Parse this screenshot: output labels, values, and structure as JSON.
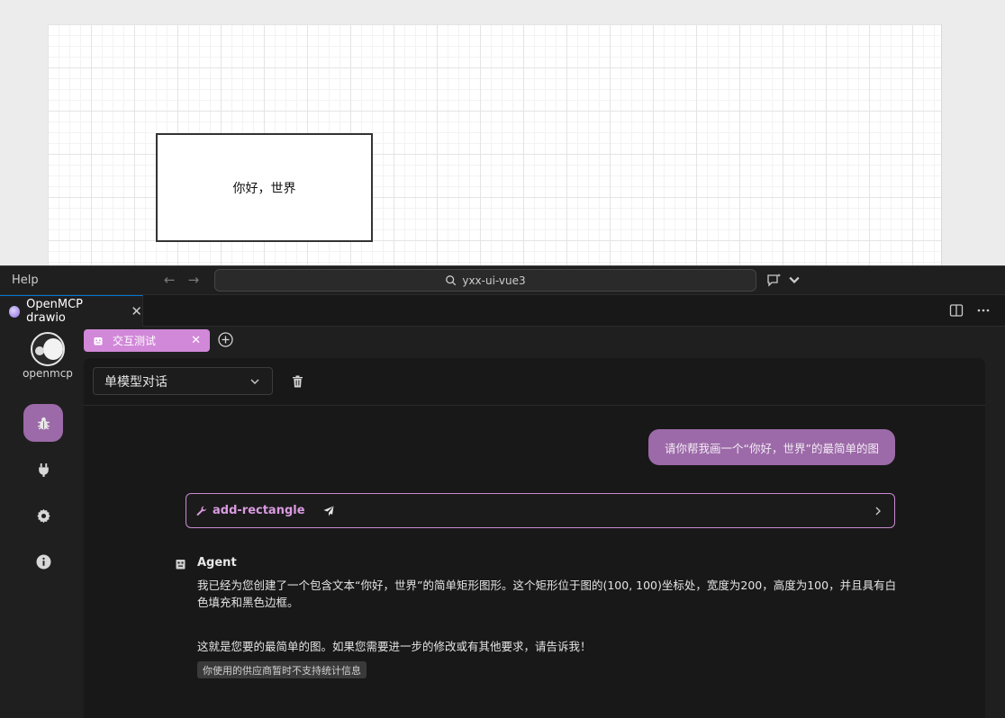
{
  "drawio": {
    "shape_text": "你好，世界"
  },
  "titlebar": {
    "menu_help": "Help",
    "search_text": "yxx-ui-vue3"
  },
  "editor_tab": {
    "label": "OpenMCP drawio"
  },
  "sidebar": {
    "logo_text": "openmcp",
    "items": [
      {
        "icon": "bug-icon",
        "active": true
      },
      {
        "icon": "plug-icon",
        "active": false
      },
      {
        "icon": "gear-icon",
        "active": false
      },
      {
        "icon": "info-icon",
        "active": false
      }
    ]
  },
  "inner_tab": {
    "label": "交互测试"
  },
  "panel": {
    "mode_select": "单模型对话"
  },
  "chat": {
    "user_message": "请你帮我画一个“你好，世界”的最简单的图",
    "tool_call": "add-rectangle",
    "agent_label": "Agent",
    "agent_paragraph_1": "我已经为您创建了一个包含文本“你好，世界”的简单矩形图形。这个矩形位于图的(100, 100)坐标处，宽度为200，高度为100，并且具有白色填充和黑色边框。",
    "agent_paragraph_2": "这就是您要的最简单的图。如果您需要进一步的修改或有其他要求，请告诉我！",
    "stats_badge": "你使用的供应商暂时不支持统计信息"
  },
  "colors": {
    "accent": "#9c6aa8",
    "tab_accent": "#d188d8",
    "tool_border": "#c98ad0",
    "background": "#1f1f1f"
  }
}
